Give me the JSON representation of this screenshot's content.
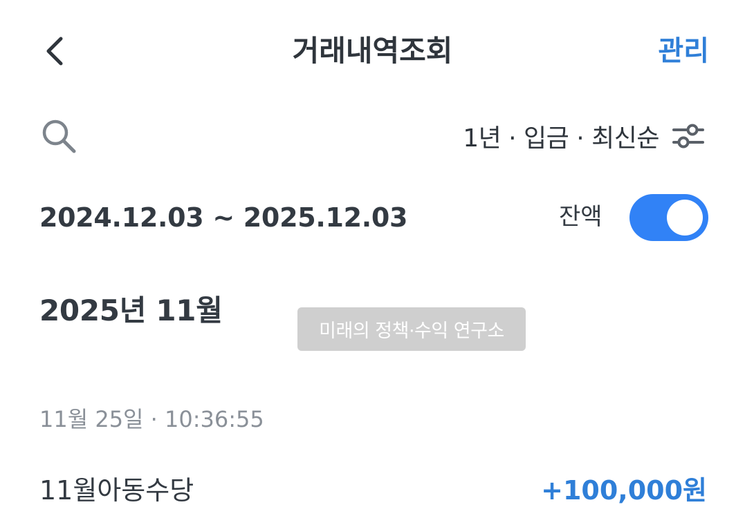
{
  "header": {
    "title": "거래내역조회",
    "manage_label": "관리"
  },
  "filter": {
    "summary": "1년 · 입금 · 최신순"
  },
  "date_range": "2024.12.03 ~ 2025.12.03",
  "balance_toggle": {
    "label": "잔액",
    "on": true
  },
  "month_heading": "2025년 11월",
  "watermark": "미래의 정책·수익 연구소",
  "transactions": [
    {
      "datetime": "11월 25일 · 10:36:55",
      "name": "11월아동수당",
      "amount": "+100,000원"
    }
  ],
  "colors": {
    "accent": "#2f7fd8",
    "toggle_on": "#3182f6",
    "text_primary": "#333a42",
    "text_secondary": "#8a9098"
  },
  "icons": {
    "back": "chevron-left-icon",
    "search": "search-icon",
    "filter": "sliders-icon"
  }
}
